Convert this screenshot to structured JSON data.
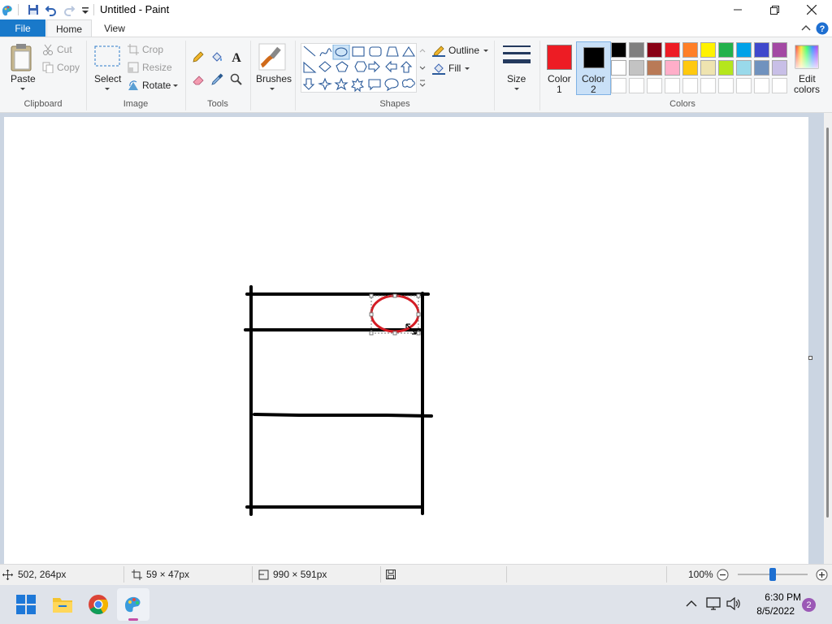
{
  "window": {
    "title": "Untitled - Paint"
  },
  "quick_access": {
    "icons": [
      "paint-app-icon",
      "save-icon",
      "undo-icon",
      "redo-icon",
      "customize-quick-access-icon"
    ]
  },
  "tabs": {
    "file": "File",
    "home": "Home",
    "view": "View"
  },
  "clipboard": {
    "paste": "Paste",
    "cut": "Cut",
    "copy": "Copy",
    "group": "Clipboard"
  },
  "image": {
    "select": "Select",
    "crop": "Crop",
    "resize": "Resize",
    "rotate": "Rotate",
    "group": "Image"
  },
  "tools": {
    "group": "Tools",
    "icons": [
      "pencil-icon",
      "fill-icon",
      "text-icon",
      "eraser-icon",
      "color-picker-icon",
      "magnifier-icon"
    ]
  },
  "brushes": {
    "label": "Brushes"
  },
  "shapes": {
    "outline": "Outline",
    "fill": "Fill",
    "group": "Shapes"
  },
  "size": {
    "label": "Size"
  },
  "colors": {
    "color1_label1": "Color",
    "color1_label2": "1",
    "color2_label1": "Color",
    "color2_label2": "2",
    "color1": "#ed1c24",
    "color2": "#000000",
    "group": "Colors",
    "edit1": "Edit",
    "edit2": "colors",
    "palette_row1": [
      "#000000",
      "#7f7f7f",
      "#880015",
      "#ed1c24",
      "#ff7f27",
      "#fff200",
      "#22b14c",
      "#00a2e8",
      "#3f48cc",
      "#a349a4"
    ],
    "palette_row2": [
      "#ffffff",
      "#c3c3c3",
      "#b97a57",
      "#ffaec9",
      "#ffc90e",
      "#efe4b0",
      "#b5e61d",
      "#99d9ea",
      "#7092be",
      "#c8bfe7"
    ],
    "palette_row3": [
      "#ffffff",
      "#ffffff",
      "#ffffff",
      "#ffffff",
      "#ffffff",
      "#ffffff",
      "#ffffff",
      "#ffffff",
      "#ffffff",
      "#ffffff"
    ]
  },
  "status": {
    "cursor": "502, 264px",
    "selection": "59 × 47px",
    "canvas_size": "990 × 591px",
    "zoom": "100%",
    "zoom_level": 0.5
  },
  "taskbar": {
    "time": "6:30 PM",
    "date": "8/5/2022",
    "notifications": "2"
  }
}
